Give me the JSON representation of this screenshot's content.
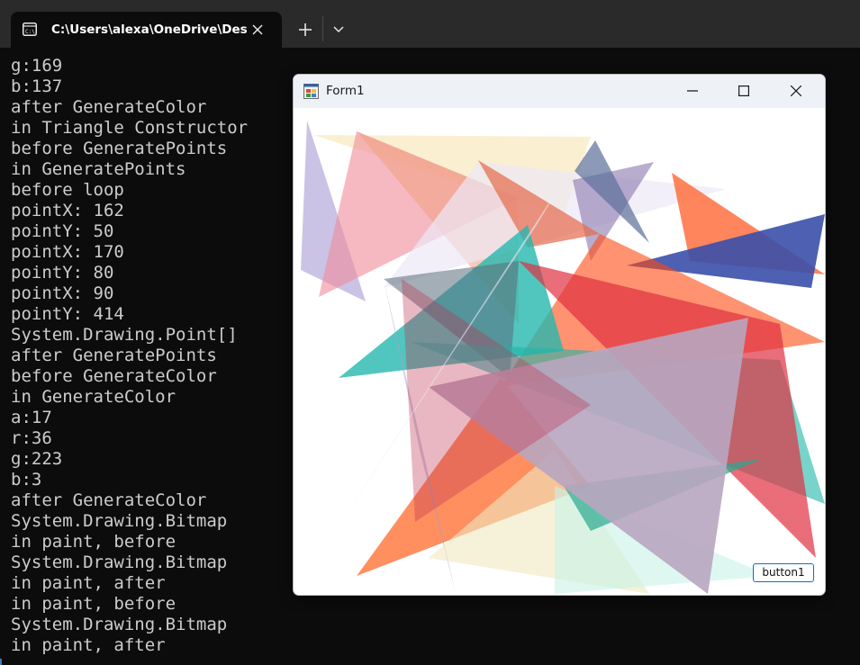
{
  "terminal": {
    "tab_title": "C:\\Users\\alexa\\OneDrive\\Desl",
    "icons": {
      "tab": "console-icon",
      "close": "close-icon",
      "new_tab": "plus-icon",
      "dropdown": "chevron-down-icon"
    },
    "console_lines": [
      "g:169",
      "b:137",
      "after GenerateColor",
      "in Triangle Constructor",
      "before GeneratePoints",
      "in GeneratePoints",
      "before loop",
      "pointX: 162",
      "pointY: 50",
      "pointX: 170",
      "pointY: 80",
      "pointX: 90",
      "pointY: 414",
      "System.Drawing.Point[]",
      "after GeneratePoints",
      "before GenerateColor",
      "in GenerateColor",
      "a:17",
      "r:36",
      "g:223",
      "b:3",
      "after GenerateColor",
      "System.Drawing.Bitmap",
      "in paint, before",
      "System.Drawing.Bitmap",
      "in paint, after",
      "in paint, before",
      "System.Drawing.Bitmap",
      "in paint, after"
    ]
  },
  "form": {
    "title": "Form1",
    "button_label": "button1",
    "icons": {
      "app": "winforms-app-icon",
      "minimize": "minimize-icon",
      "maximize": "maximize-icon",
      "close": "close-icon"
    }
  },
  "colors": {
    "terminal_bg": "#0c0c0c",
    "titlebar_bg": "#2a2a2a",
    "console_text": "#cccccc",
    "accent": "#0b6fd1"
  }
}
